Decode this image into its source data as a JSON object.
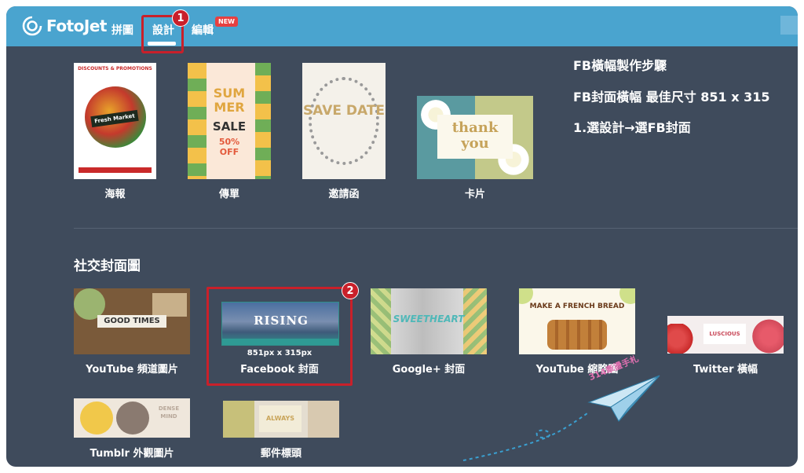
{
  "header": {
    "logo_text": "FotoJet",
    "nav": [
      {
        "label": "拼圖"
      },
      {
        "label": "設計"
      },
      {
        "label": "編輯"
      }
    ],
    "new_badge": "NEW",
    "step1_number": "1"
  },
  "design_items": [
    {
      "label": "海報",
      "thumb_text": "Fresh Market"
    },
    {
      "label": "傳單",
      "thumb_text": "SALE"
    },
    {
      "label": "邀請函",
      "thumb_text": "SAVE DATE"
    },
    {
      "label": "卡片",
      "thumb_text": "thank you"
    }
  ],
  "social_section": {
    "title": "社交封面圖",
    "step2_number": "2",
    "items": [
      {
        "label": "YouTube 頻道圖片",
        "thumb_text": "GOOD TIMES"
      },
      {
        "label": "Facebook 封面",
        "size_text": "851px x 315px",
        "thumb_text": "RISING"
      },
      {
        "label": "Google+ 封面",
        "thumb_text": "SWEETHEART"
      },
      {
        "label": "YouTube 縮略圖",
        "thumb_text": "MAKE A FRENCH BREAD"
      },
      {
        "label": "Twitter 橫幅",
        "thumb_text": "LUSCIOUS"
      },
      {
        "label": "Tumblr 外觀圖片",
        "thumb_text": "DENSE MIND"
      },
      {
        "label": "郵件標頭",
        "thumb_text": "ALWAYS"
      }
    ]
  },
  "notes": {
    "line1": "FB橫幅製作步驟",
    "line2": "FB封面橫幅 最佳尺寸 851 x 315",
    "line3": "1.選設計→選FB封面"
  },
  "watermark": "314牽盪手札",
  "colors": {
    "background": "#3f4b5c",
    "topbar": "#4aa4cf",
    "highlight": "#c9202a"
  }
}
